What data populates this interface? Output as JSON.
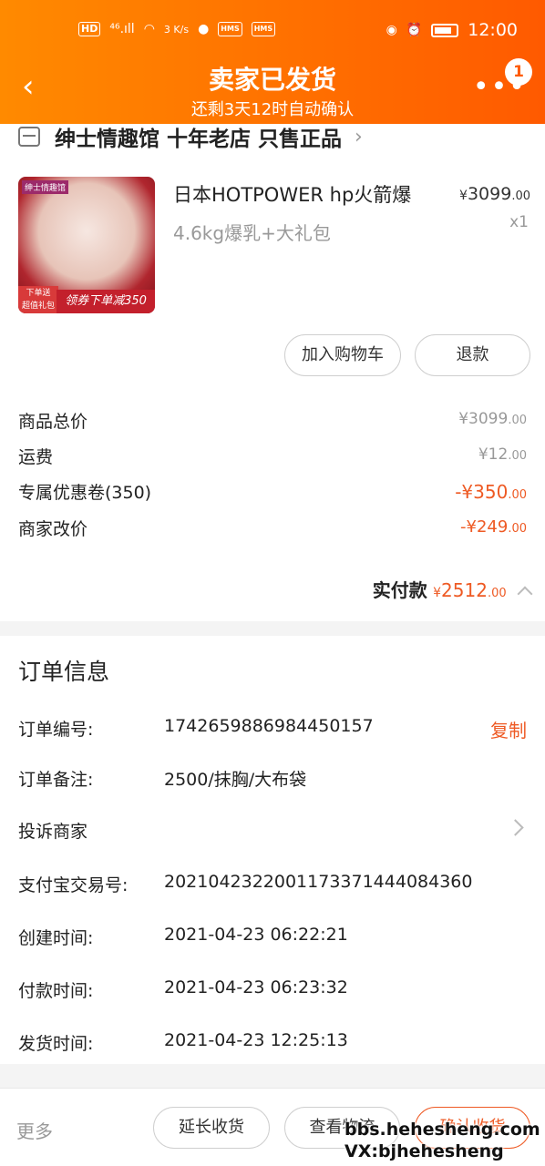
{
  "status_bar": {
    "hd": "HD",
    "signal": "⁴⁶.ıll",
    "speed": "3 K/s",
    "hms1": "HMS",
    "hms2": "HMS",
    "time": "12:00"
  },
  "header": {
    "title": "卖家已发货",
    "subtitle": "还剩3天12时自动确认",
    "badge_count": "1"
  },
  "shop": {
    "name": "绅士情趣馆 十年老店 只售正品"
  },
  "product": {
    "title": "日本HOTPOWER hp火箭爆",
    "spec": "4.6kg爆乳+大礼包",
    "price_yen": "¥",
    "price_int": "3099",
    "price_dec": ".00",
    "qty": "x1",
    "image_tag": "绅士情趣馆",
    "image_promo": "领券下单减350",
    "image_gift": "下单送\n超值礼包",
    "image_gift_line1": "下单送",
    "image_gift_line2": "超值礼包"
  },
  "actions": {
    "add_cart": "加入购物车",
    "refund": "退款"
  },
  "costs": [
    {
      "label": "商品总价",
      "value": "¥3099",
      "dec": ".00",
      "color": "gray"
    },
    {
      "label": "运费",
      "value": "¥12",
      "dec": ".00",
      "color": "gray"
    },
    {
      "label": "专属优惠卷(350)",
      "value": "-¥350",
      "dec": ".00",
      "color": "orange"
    },
    {
      "label": "商家改价",
      "value": "-¥249",
      "dec": ".00",
      "color": "orange"
    }
  ],
  "total": {
    "label": "实付款",
    "yen": "¥",
    "value": "2512",
    "dec": ".00"
  },
  "order_info": {
    "title": "订单信息",
    "copy": "复制",
    "rows": [
      {
        "label": "订单编号:",
        "value": "1742659886984450157"
      },
      {
        "label": "订单备注:",
        "value": "2500/抹胸/大布袋"
      },
      {
        "label": "投诉商家",
        "value": ""
      },
      {
        "label": "支付宝交易号:",
        "value": "2021042322001173371444084360"
      },
      {
        "label": "创建时间:",
        "value": "2021-04-23 06:22:21"
      },
      {
        "label": "付款时间:",
        "value": "2021-04-23 06:23:32"
      },
      {
        "label": "发货时间:",
        "value": "2021-04-23 12:25:13"
      }
    ]
  },
  "bottom_bar": {
    "more": "更多",
    "extend": "延长收货",
    "logistics": "查看物流",
    "confirm": "确认收货"
  },
  "watermark": {
    "line1": "bbs.hehesheng.com",
    "line2": "VX:bjhehesheng"
  },
  "colors": {
    "header_start": "#ff8a00",
    "header_end": "#ff5a00",
    "accent": "#ee5a24"
  },
  "icons": [
    "back-arrow-icon",
    "more-dots-icon",
    "shop-icon",
    "chevron-right-icon",
    "chevron-up-icon",
    "eye-icon",
    "alarm-icon",
    "battery-icon",
    "wifi-icon"
  ]
}
